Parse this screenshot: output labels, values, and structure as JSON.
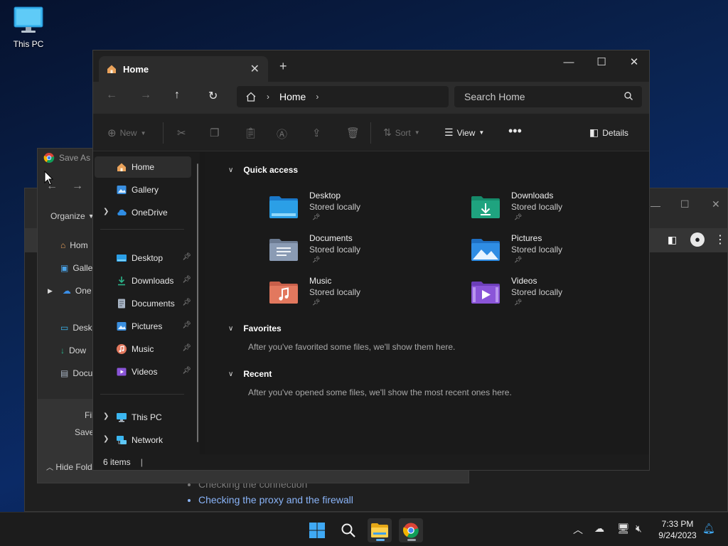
{
  "desktop": {
    "this_pc_label": "This PC"
  },
  "chrome_bg": {
    "bullets": [
      "Checking the connection",
      "Checking the proxy and the firewall"
    ]
  },
  "save_as": {
    "title": "Save As",
    "organize": "Organize",
    "sidebar": [
      "Hom",
      "Galle",
      "One",
      "Desk",
      "Dow",
      "Docu"
    ],
    "file_label": "Fil",
    "save_label": "Save",
    "hide_folders": "Hide Fold"
  },
  "explorer": {
    "tab_title": "Home",
    "address": {
      "segment": "Home"
    },
    "search_placeholder": "Search Home",
    "commands": {
      "new": "New",
      "sort": "Sort",
      "view": "View",
      "details": "Details"
    },
    "nav": {
      "home": "Home",
      "gallery": "Gallery",
      "onedrive": "OneDrive",
      "desktop": "Desktop",
      "downloads": "Downloads",
      "documents": "Documents",
      "pictures": "Pictures",
      "music": "Music",
      "videos": "Videos",
      "this_pc": "This PC",
      "network": "Network"
    },
    "quick_access": {
      "title": "Quick access",
      "items": [
        {
          "name": "Desktop",
          "sub": "Stored locally",
          "color": "#2b9fe6"
        },
        {
          "name": "Downloads",
          "sub": "Stored locally",
          "color": "#1fa37f"
        },
        {
          "name": "Documents",
          "sub": "Stored locally",
          "color": "#8a9bb4"
        },
        {
          "name": "Pictures",
          "sub": "Stored locally",
          "color": "#2f8de4"
        },
        {
          "name": "Music",
          "sub": "Stored locally",
          "color": "#e2785e"
        },
        {
          "name": "Videos",
          "sub": "Stored locally",
          "color": "#8a55d8"
        }
      ]
    },
    "favorites": {
      "title": "Favorites",
      "hint": "After you've favorited some files, we'll show them here."
    },
    "recent": {
      "title": "Recent",
      "hint": "After you've opened some files, we'll show the most recent ones here."
    },
    "status": "6 items"
  },
  "taskbar": {
    "time": "7:33 PM",
    "date": "9/24/2023"
  }
}
